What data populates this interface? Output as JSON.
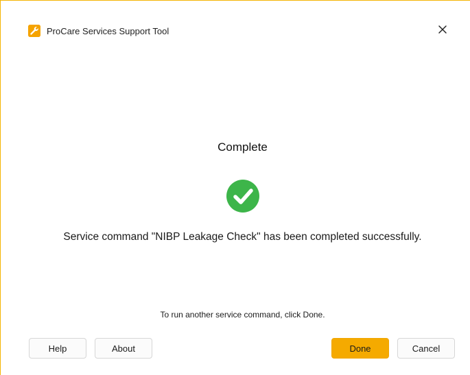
{
  "window": {
    "title": "ProCare Services Support Tool",
    "app_icon": "wrench-icon",
    "close_icon": "close-icon",
    "close_glyph": "✕"
  },
  "main": {
    "heading": "Complete",
    "status_icon": "check-circle-icon",
    "message": "Service command \"NIBP Leakage Check\" has been completed successfully.",
    "hint": "To run another service command, click Done."
  },
  "buttons": {
    "help": "Help",
    "about": "About",
    "done": "Done",
    "cancel": "Cancel"
  },
  "colors": {
    "accent": "#f5aa00",
    "success": "#3db54a",
    "window_border": "#f5b400"
  }
}
